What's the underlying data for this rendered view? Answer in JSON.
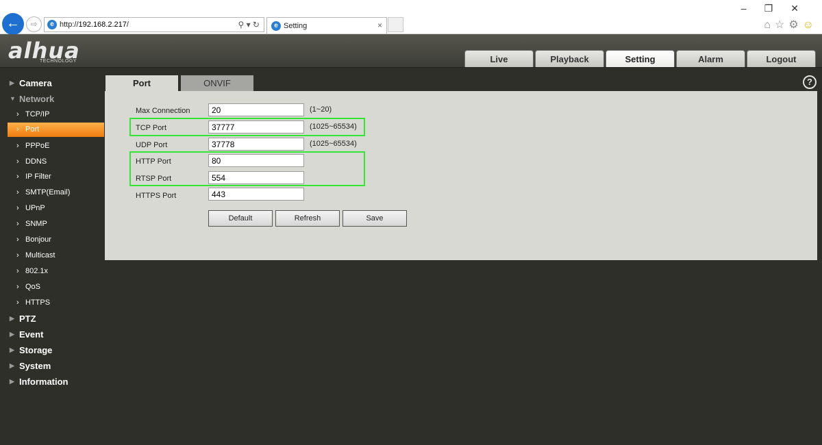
{
  "browser": {
    "url_prefix": "http://",
    "url_host": "192.168.2.217",
    "url_suffix": "/",
    "tab_title": "Setting",
    "tab_close": "×",
    "back_arrow": "←",
    "forward_arrow": "⇨",
    "ie_glyph": "e",
    "address_tools": "⚲ ▾ ↻",
    "window_controls": "–❐✕",
    "toolbar_icons": [
      "home-icon",
      "star-icon",
      "gear-icon",
      "smiley-icon"
    ],
    "toolbar_glyphs": [
      "⌂",
      "☆",
      "⚙",
      "☺"
    ]
  },
  "logo": {
    "text": "alhua",
    "subtext": "TECHNOLOGY"
  },
  "main_tabs": [
    {
      "label": "Live",
      "active": false
    },
    {
      "label": "Playback",
      "active": false
    },
    {
      "label": "Setting",
      "active": true
    },
    {
      "label": "Alarm",
      "active": false
    },
    {
      "label": "Logout",
      "active": false
    }
  ],
  "sidebar": {
    "camera": "Camera",
    "network": "Network",
    "network_items": [
      "TCP/IP",
      "Port",
      "PPPoE",
      "DDNS",
      "IP Filter",
      "SMTP(Email)",
      "UPnP",
      "SNMP",
      "Bonjour",
      "Multicast",
      "802.1x",
      "QoS",
      "HTTPS"
    ],
    "active_item": "Port",
    "bottom": [
      "PTZ",
      "Event",
      "Storage",
      "System",
      "Information"
    ],
    "collapsed_arrow": "▶",
    "expanded_arrow": "▼",
    "chevron": "›"
  },
  "content_tabs": {
    "port": "Port",
    "onvif": "ONVIF"
  },
  "help": "?",
  "form": {
    "max_connection": {
      "label": "Max Connection",
      "value": "20",
      "range": "(1~20)"
    },
    "tcp_port": {
      "label": "TCP Port",
      "value": "37777",
      "range": "(1025~65534)"
    },
    "udp_port": {
      "label": "UDP Port",
      "value": "37778",
      "range": "(1025~65534)"
    },
    "http_port": {
      "label": "HTTP Port",
      "value": "80"
    },
    "rtsp_port": {
      "label": "RTSP Port",
      "value": "554"
    },
    "https_port": {
      "label": "HTTPS Port",
      "value": "443"
    }
  },
  "buttons": {
    "default": "Default",
    "refresh": "Refresh",
    "save": "Save"
  },
  "colors": {
    "highlight": "#34e534",
    "active_item": "#ef7c10",
    "panel": "#d8d9d3",
    "background": "#2f2f2a"
  }
}
